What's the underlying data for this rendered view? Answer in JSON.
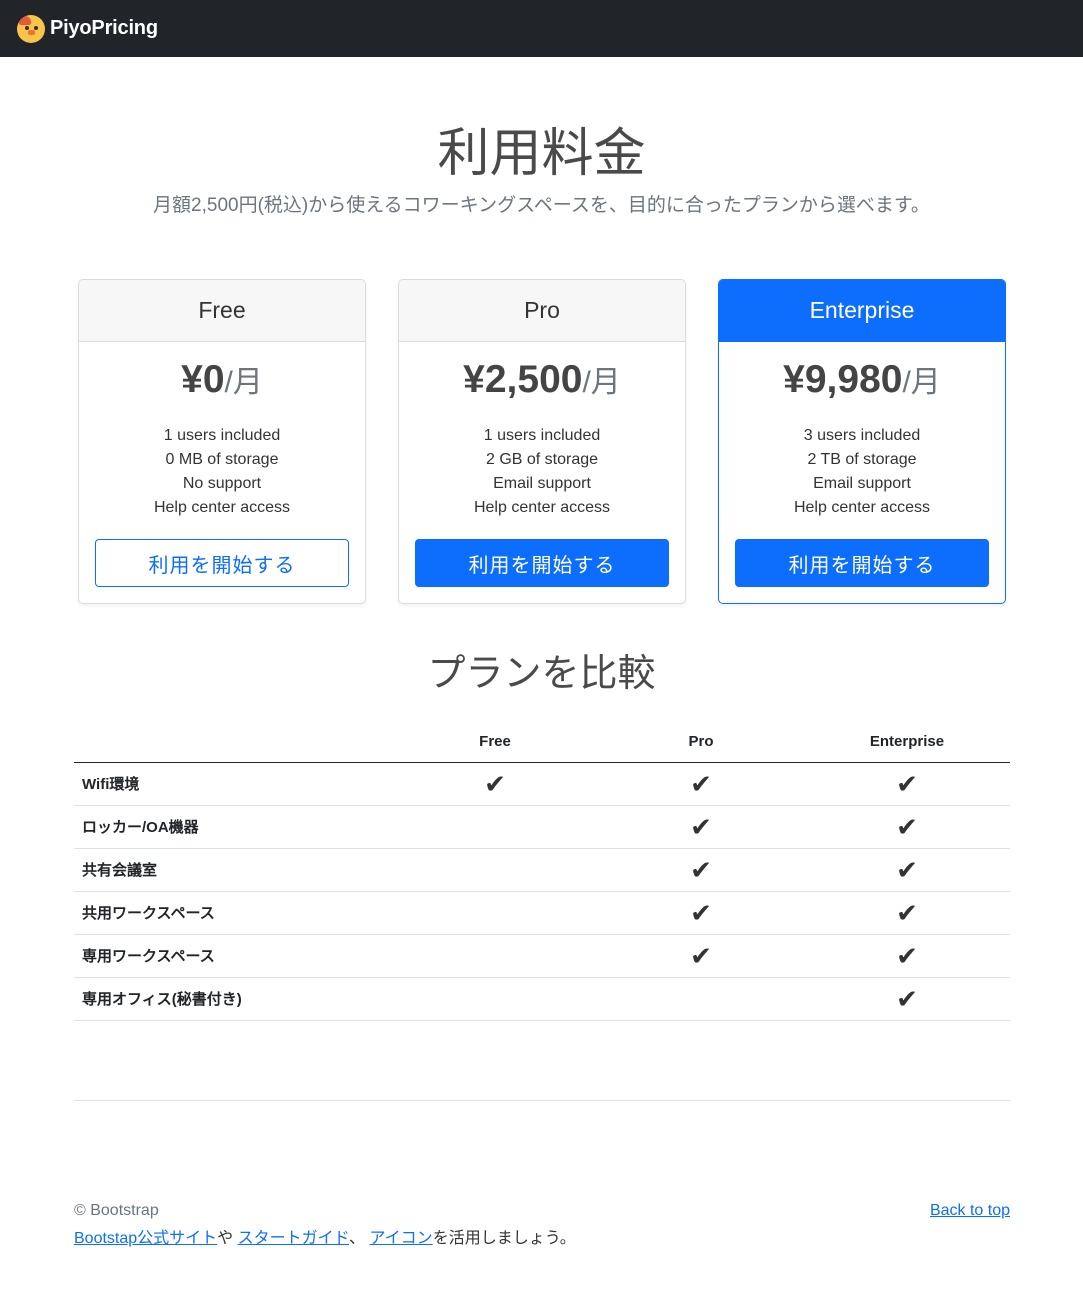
{
  "navbar": {
    "brand": "PiyoPricing",
    "logo_icon": "chick-logo-icon"
  },
  "hero": {
    "title": "利用料金",
    "subtitle": "月額2,500円(税込)から使えるコワーキングスペースを、目的に合ったプランから選べます。"
  },
  "plans": [
    {
      "name": "Free",
      "price": "¥0",
      "unit": "/月",
      "features": [
        "1 users included",
        "0 MB of storage",
        "No support",
        "Help center access"
      ],
      "button": "利用を開始する"
    },
    {
      "name": "Pro",
      "price": "¥2,500",
      "unit": "/月",
      "features": [
        "1 users included",
        "2 GB of storage",
        "Email support",
        "Help center access"
      ],
      "button": "利用を開始する"
    },
    {
      "name": "Enterprise",
      "price": "¥9,980",
      "unit": "/月",
      "features": [
        "3 users included",
        "2 TB of storage",
        "Email support",
        "Help center access"
      ],
      "button": "利用を開始する"
    }
  ],
  "compare": {
    "title": "プランを比較",
    "columns": [
      "Free",
      "Pro",
      "Enterprise"
    ],
    "check_glyph": "✔",
    "rows": [
      {
        "name": "Wifi環境",
        "checks": [
          true,
          true,
          true
        ]
      },
      {
        "name": "ロッカー/OA機器",
        "checks": [
          false,
          true,
          true
        ]
      },
      {
        "name": "共有会議室",
        "checks": [
          false,
          true,
          true
        ]
      },
      {
        "name": "共用ワークスペース",
        "checks": [
          false,
          true,
          true
        ]
      },
      {
        "name": "専用ワークスペース",
        "checks": [
          false,
          true,
          true
        ]
      },
      {
        "name": "専用オフィス(秘書付き)",
        "checks": [
          false,
          false,
          true
        ]
      }
    ]
  },
  "footer": {
    "copyright": "© Bootstrap",
    "link_official": "Bootstap公式サイト",
    "sep1": "や",
    "link_guide": "スタートガイド",
    "sep2": "、",
    "link_icons": "アイコン",
    "tail": "を活用しましょう。",
    "back_to_top": "Back to top"
  },
  "colors": {
    "primary": "#0d6efd",
    "navbar": "#212529"
  }
}
